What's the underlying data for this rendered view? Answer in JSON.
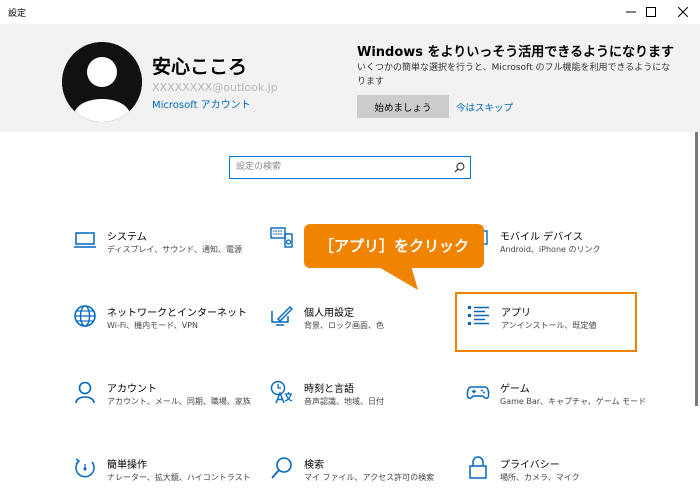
{
  "window": {
    "title": "設定",
    "minimize_icon": "minimize-icon",
    "maximize_icon": "maximize-icon",
    "close_icon": "close-icon"
  },
  "account": {
    "name": "安心こころ",
    "email": "XXXXXXXX@outlook.jp",
    "link": "Microsoft アカウント"
  },
  "promo": {
    "title": "Windows をよりいっそう活用できるようになります",
    "description": "いくつかの簡単な選択を行うと、Microsoft のフル機能を利用できるようになります",
    "start_button": "始めましょう",
    "skip_link": "今はスキップ"
  },
  "search": {
    "placeholder": "設定の検索"
  },
  "callout": {
    "text": "［アプリ］をクリック",
    "color": "#f08300"
  },
  "accent": "#0067c0",
  "items": [
    {
      "name": "システム",
      "desc": "ディスプレイ、サウンド、通知、電源",
      "icon": "laptop-icon"
    },
    {
      "name": "デバイス",
      "desc": "Bluetooth、プリンター、マウス",
      "icon": "keyboard-speaker-icon"
    },
    {
      "name": "モバイル デバイス",
      "desc": "Android、iPhone のリンク",
      "icon": "phone-icon"
    },
    {
      "name": "ネットワークとインターネット",
      "desc": "Wi-Fi、機内モード、VPN",
      "icon": "globe-icon"
    },
    {
      "name": "個人用設定",
      "desc": "背景、ロック画面、色",
      "icon": "pen-monitor-icon"
    },
    {
      "name": "アプリ",
      "desc": "アンインストール、既定値",
      "icon": "apps-list-icon"
    },
    {
      "name": "アカウント",
      "desc": "アカウント、メール、同期、職場、家族",
      "icon": "person-icon"
    },
    {
      "name": "時刻と言語",
      "desc": "音声認識、地域、日付",
      "icon": "time-language-icon"
    },
    {
      "name": "ゲーム",
      "desc": "Game Bar、キャプチャ、ゲーム モード",
      "icon": "gamepad-icon"
    },
    {
      "name": "簡単操作",
      "desc": "ナレーター、拡大鏡、ハイコントラスト",
      "icon": "ease-of-access-icon"
    },
    {
      "name": "検索",
      "desc": "マイ ファイル、アクセス許可の検索",
      "icon": "search-icon"
    },
    {
      "name": "プライバシー",
      "desc": "場所、カメラ、マイク",
      "icon": "lock-icon"
    }
  ]
}
